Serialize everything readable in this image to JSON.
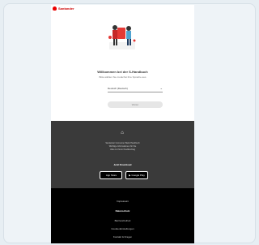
{
  "brand": {
    "name": "Santander",
    "accent": "#ec0000"
  },
  "main": {
    "welcome": "Willkommen bei der S-Handbuch",
    "subtitle": "Bitte wählen Sie zunächst Ihre Sprache aus",
    "select_value": "Deutsch (Deutsch)",
    "next_label": "Weiter"
  },
  "info": {
    "lines": [
      "Santander Consumer Bank Handbuch",
      "Wichtige Informationen für Sie",
      "Alles zu Ihrem Kreditvertrag"
    ],
    "download_label": "Jetzt Download",
    "app_store": "App Store",
    "google_play": "Google Play"
  },
  "footer": {
    "links": [
      "Impressum",
      "Datenschutz",
      "Barrierefreiheit",
      "Cookie-Einstellungen",
      "Kontakt & Fragen"
    ]
  }
}
